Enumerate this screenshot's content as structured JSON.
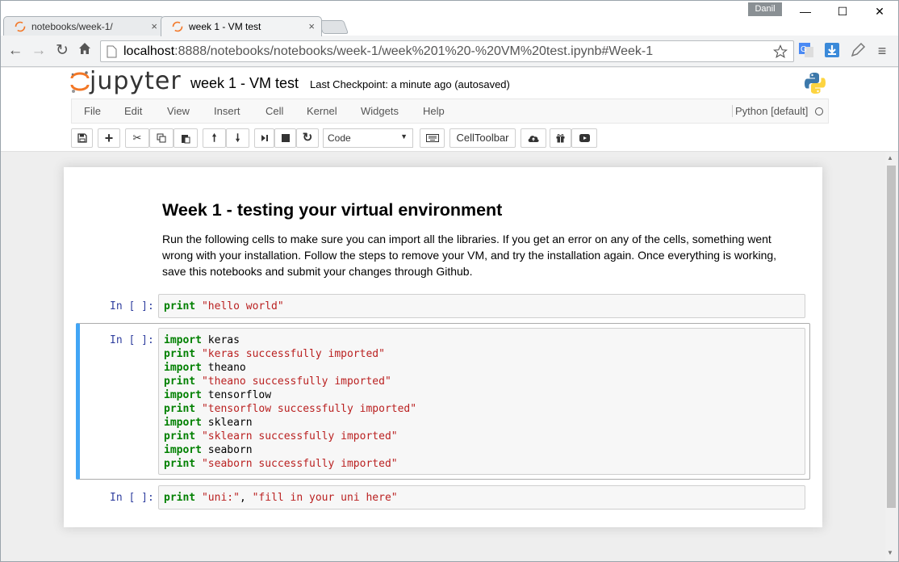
{
  "browser": {
    "tabs": [
      {
        "title": "notebooks/week-1/",
        "close": "×"
      },
      {
        "title": "week 1 - VM test",
        "close": "×"
      }
    ],
    "user": "Danil",
    "window_buttons": {
      "minimize": "—",
      "maximize": "☐",
      "close": "✕"
    },
    "url_host": "localhost",
    "url_rest": ":8888/notebooks/notebooks/week-1/week%201%20-%20VM%20test.ipynb#Week-1"
  },
  "jupyter": {
    "logo_text": "jupyter",
    "notebook_name": "week 1 - VM test",
    "checkpoint": "Last Checkpoint: a minute ago (autosaved)",
    "menu": [
      "File",
      "Edit",
      "View",
      "Insert",
      "Cell",
      "Kernel",
      "Widgets",
      "Help"
    ],
    "kernel": "Python [default]",
    "cell_type": "Code",
    "celltoolbar_label": "CellToolbar"
  },
  "notebook": {
    "heading": "Week 1 - testing your virtual environment",
    "paragraph": "Run the following cells to make sure you can import all the libraries. If you get an error on any of the cells, something went wrong with your installation. Follow the steps to remove your VM, and try the installation again. Once everything is working, save this notebooks and submit your changes through Github.",
    "prompt": "In [ ]:",
    "cell1": [
      {
        "kw": "print",
        "str": "\"hello world\""
      }
    ],
    "cell2": [
      {
        "kw": "import",
        "text": "keras"
      },
      {
        "kw": "print",
        "str": "\"keras successfully imported\""
      },
      {
        "kw": "import",
        "text": "theano"
      },
      {
        "kw": "print",
        "str": "\"theano successfully imported\""
      },
      {
        "kw": "import",
        "text": "tensorflow"
      },
      {
        "kw": "print",
        "str": "\"tensorflow successfully imported\""
      },
      {
        "kw": "import",
        "text": "sklearn"
      },
      {
        "kw": "print",
        "str": "\"sklearn successfully imported\""
      },
      {
        "kw": "import",
        "text": "seaborn"
      },
      {
        "kw": "print",
        "str": "\"seaborn successfully imported\""
      }
    ],
    "cell3": {
      "kw": "print",
      "str1": "\"uni:\"",
      "sep": ", ",
      "str2": "\"fill in your uni here\""
    }
  }
}
